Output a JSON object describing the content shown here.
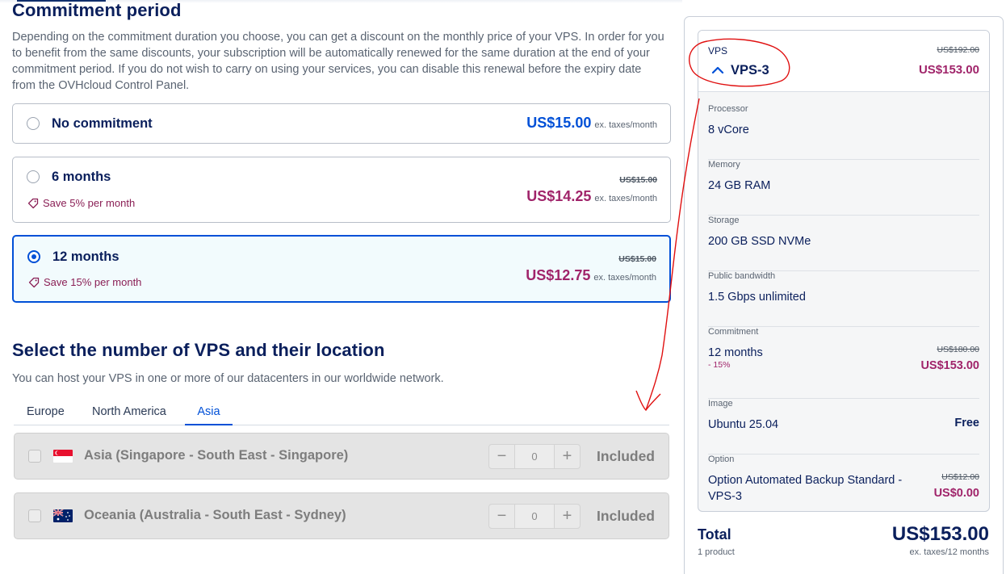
{
  "commitment": {
    "title": "Commitment period",
    "description": "Depending on the commitment duration you choose, you can get a discount on the monthly price of your VPS. In order for you to benefit from the same discounts, your subscription will be automatically renewed for the same duration at the end of your commitment period. If you do not wish to carry on using your services, you can disable this renewal before the expiry date from the OVHcloud Control Panel.",
    "options": [
      {
        "label": "No commitment",
        "save": "",
        "old_price": "",
        "price": "US$15.00",
        "unit": "ex. taxes/month",
        "selected": false
      },
      {
        "label": "6 months",
        "save": "Save 5% per month",
        "old_price": "US$15.00",
        "price": "US$14.25",
        "unit": "ex. taxes/month",
        "selected": false
      },
      {
        "label": "12 months",
        "save": "Save 15% per month",
        "old_price": "US$15.00",
        "price": "US$12.75",
        "unit": "ex. taxes/month",
        "selected": true
      }
    ]
  },
  "location": {
    "title": "Select the number of VPS and their location",
    "description": "You can host your VPS in one or more of our datacenters in our worldwide network.",
    "tabs": [
      {
        "label": "Europe",
        "active": false
      },
      {
        "label": "North America",
        "active": false
      },
      {
        "label": "Asia",
        "active": true
      }
    ],
    "rows": [
      {
        "flag": "singapore-flag",
        "label": "Asia (Singapore - South East - Singapore)",
        "quantity": "0",
        "minus": "−",
        "plus": "+",
        "status": "Included"
      },
      {
        "flag": "australia-flag",
        "label": "Oceania (Australia - South East - Sydney)",
        "quantity": "0",
        "minus": "−",
        "plus": "+",
        "status": "Included"
      }
    ]
  },
  "summary": {
    "product_label": "VPS",
    "product_name": "VPS-3",
    "product_old_price": "US$192.00",
    "product_price": "US$153.00",
    "items": [
      {
        "label": "Processor",
        "value": "8 vCore"
      },
      {
        "label": "Memory",
        "value": "24 GB RAM"
      },
      {
        "label": "Storage",
        "value": "200 GB SSD NVMe"
      },
      {
        "label": "Public bandwidth",
        "value": "1.5 Gbps unlimited"
      },
      {
        "label": "Commitment",
        "value": "12 months",
        "discount": "- 15%",
        "old_price": "US$180.00",
        "price": "US$153.00"
      },
      {
        "label": "Image",
        "value": "Ubuntu 25.04",
        "price_text": "Free"
      },
      {
        "label": "Option",
        "value_line1": "Option Automated Backup Standard -",
        "value_line2": "VPS-3",
        "old_price": "US$12.00",
        "price": "US$0.00"
      }
    ],
    "total_label": "Total",
    "total_sub": "1 product",
    "total_price": "US$153.00",
    "total_unit": "ex. taxes/12 months"
  },
  "colors": {
    "primary": "#0050d7",
    "navy": "#0a1f5c",
    "discount": "#a0246a",
    "annotation": "#e01010"
  }
}
